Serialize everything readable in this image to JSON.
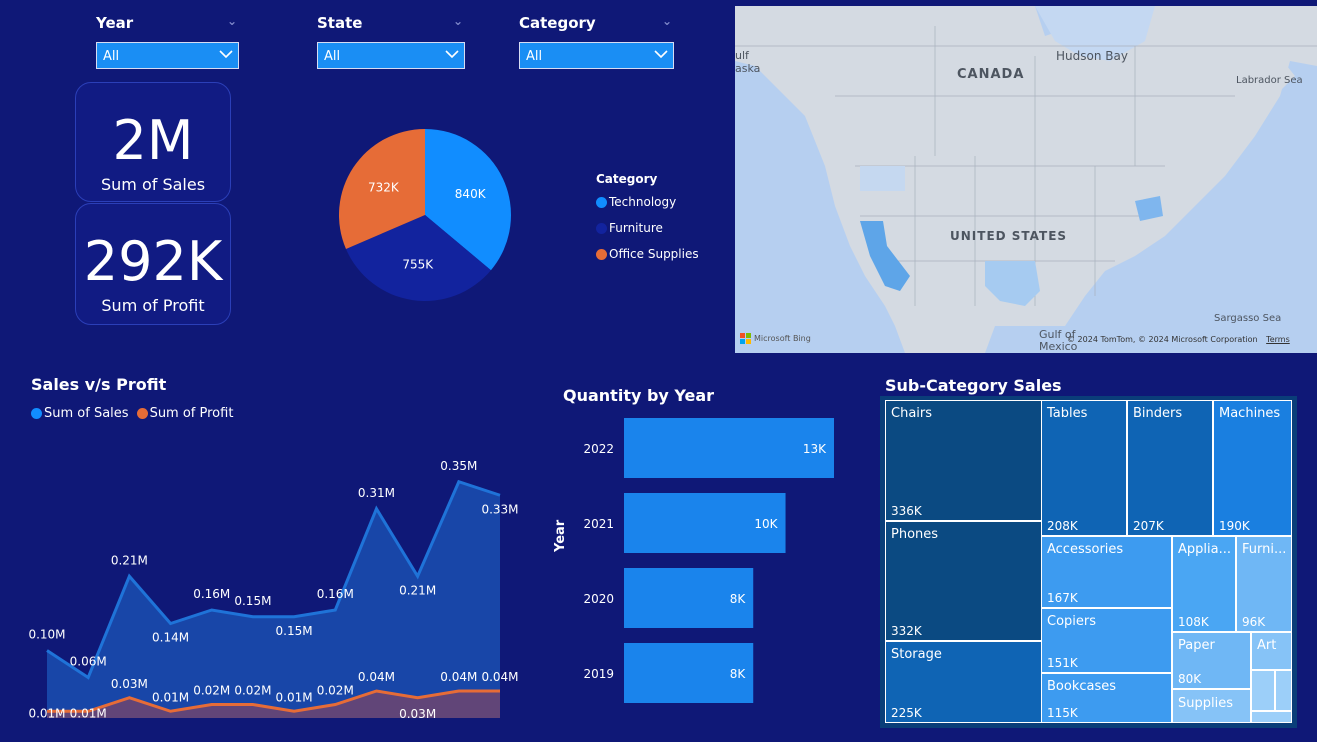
{
  "filters": [
    {
      "label": "Year",
      "value": "All"
    },
    {
      "label": "State",
      "value": "All"
    },
    {
      "label": "Category",
      "value": "All"
    }
  ],
  "kpis": {
    "sales": {
      "value": "2M",
      "label": "Sum of Sales"
    },
    "profit": {
      "value": "292K",
      "label": "Sum of Profit"
    }
  },
  "category_pie": {
    "legend_title": "Category",
    "slices": [
      {
        "name": "Technology",
        "value": 840,
        "label": "840K",
        "color": "#118dff"
      },
      {
        "name": "Furniture",
        "value": 755,
        "label": "755K",
        "color": "#12239e"
      },
      {
        "name": "Office Supplies",
        "value": 732,
        "label": "732K",
        "color": "#e66c37"
      }
    ]
  },
  "map": {
    "labels": {
      "canada": "CANADA",
      "us": "UNITED STATES",
      "hudson": "Hudson Bay",
      "labrador": "Labrador Sea",
      "sargasso": "Sargasso Sea",
      "gulf1": "Gulf of",
      "gulf2": "Mexico",
      "alaska1": "ulf",
      "alaska2": "aska"
    },
    "bing": "Microsoft Bing",
    "copyright": "© 2024 TomTom, © 2024 Microsoft Corporation",
    "terms": "Terms"
  },
  "sales_profit": {
    "title": "Sales v/s Profit",
    "legend": [
      {
        "name": "Sum of Sales",
        "color": "#118dff"
      },
      {
        "name": "Sum of Profit",
        "color": "#e66c37"
      }
    ]
  },
  "quantity": {
    "title": "Quantity by Year",
    "axis_label": "Year"
  },
  "subcat": {
    "title": "Sub-Category Sales",
    "tiles": [
      {
        "name": "Chairs",
        "value": "336K"
      },
      {
        "name": "Phones",
        "value": "332K"
      },
      {
        "name": "Storage",
        "value": "225K"
      },
      {
        "name": "Tables",
        "value": "208K"
      },
      {
        "name": "Binders",
        "value": "207K"
      },
      {
        "name": "Machines",
        "value": "190K"
      },
      {
        "name": "Accessories",
        "value": "167K"
      },
      {
        "name": "Copiers",
        "value": "151K"
      },
      {
        "name": "Bookcases",
        "value": "115K"
      },
      {
        "name": "Applia...",
        "value": "108K"
      },
      {
        "name": "Furni...",
        "value": "96K"
      },
      {
        "name": "Paper",
        "value": "80K"
      },
      {
        "name": "Art",
        "value": ""
      },
      {
        "name": "Supplies",
        "value": ""
      }
    ]
  },
  "chart_data": [
    {
      "type": "area",
      "title": "Sales v/s Profit",
      "series": [
        {
          "name": "Sum of Sales",
          "values": [
            0.1,
            0.06,
            0.21,
            0.14,
            0.16,
            0.15,
            0.15,
            0.16,
            0.31,
            0.21,
            0.35,
            0.33
          ],
          "labels": [
            "0.10M",
            "0.06M",
            "0.21M",
            "0.14M",
            "0.16M",
            "0.15M",
            "0.15M",
            "0.16M",
            "0.31M",
            "0.21M",
            "0.35M",
            "0.33M"
          ]
        },
        {
          "name": "Sum of Profit",
          "values": [
            0.01,
            0.01,
            0.03,
            0.01,
            0.02,
            0.02,
            0.01,
            0.02,
            0.04,
            0.03,
            0.04,
            0.04
          ],
          "labels": [
            "0.01M",
            "0.01M",
            "0.03M",
            "0.01M",
            "0.02M",
            "0.02M",
            "0.01M",
            "0.02M",
            "0.04M",
            "0.03M",
            "0.04M",
            "0.04M"
          ]
        }
      ]
    },
    {
      "type": "bar",
      "title": "Quantity by Year",
      "ylabel": "Year",
      "categories": [
        "2022",
        "2021",
        "2020",
        "2019"
      ],
      "values": [
        13,
        10,
        8,
        8
      ],
      "labels": [
        "13K",
        "10K",
        "8K",
        "8K"
      ]
    },
    {
      "type": "pie",
      "categories": [
        "Technology",
        "Furniture",
        "Office Supplies"
      ],
      "values": [
        840,
        755,
        732
      ]
    }
  ]
}
